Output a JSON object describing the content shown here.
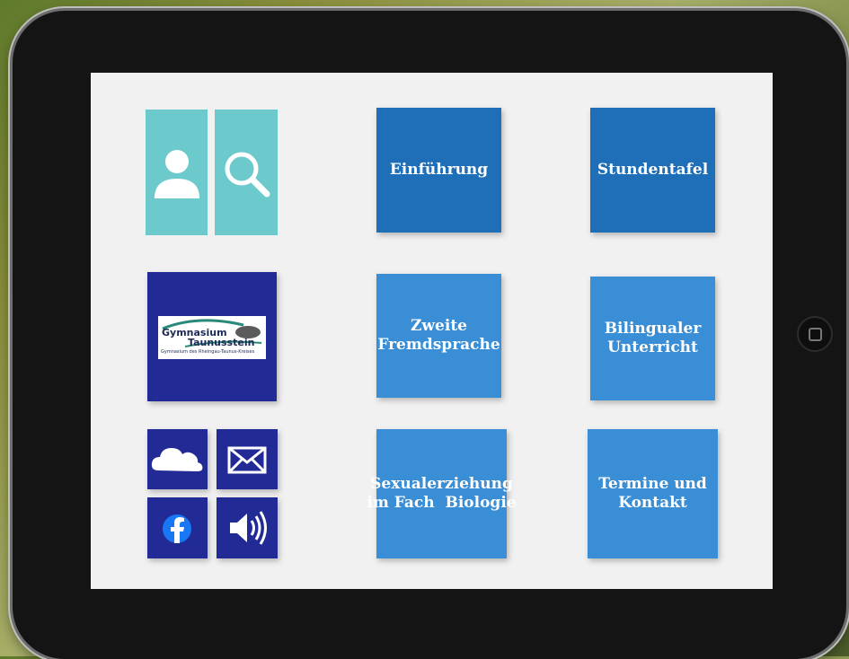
{
  "tiles": {
    "einfuehrung": "Einführung",
    "stundentafel": "Stundentafel",
    "zweite_line1": "Zweite",
    "zweite_line2": "Fremdsprache",
    "bilingual_line1": "Bilingualer",
    "bilingual_line2": "Unterricht",
    "sexual_line1": "Sexualerziehung",
    "sexual_line2": "im Fach  Biologie",
    "termine_line1": "Termine und",
    "termine_line2": "Kontakt"
  },
  "logo": {
    "line1": "Gymnasium",
    "line2": "Taunusstein",
    "subtitle": "Gymnasium des Rheingau-Taunus-Kreises"
  },
  "icons": {
    "person": "person-icon",
    "search": "search-icon",
    "cloud": "cloud-icon",
    "mail": "mail-icon",
    "facebook": "facebook-icon",
    "sound": "speaker-icon"
  },
  "colors": {
    "teal": "#6cc9cc",
    "navy": "#222a95",
    "tile_dark": "#1f6fb8",
    "tile_light": "#3a8ed6",
    "screen_bg": "#f1f1f2"
  }
}
